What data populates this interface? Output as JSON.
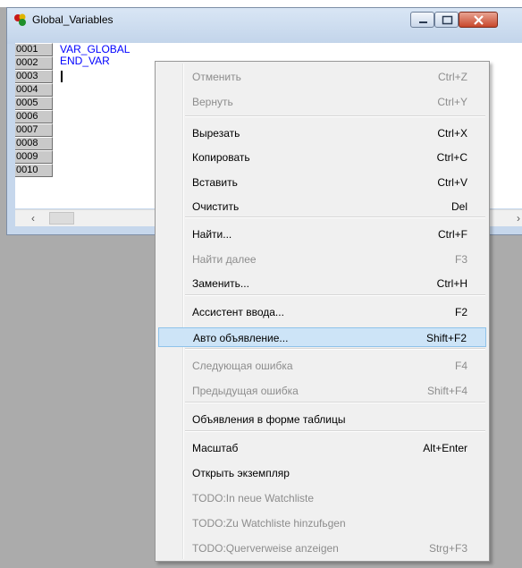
{
  "window": {
    "title": "Global_Variables",
    "line_numbers": [
      "0001",
      "0002",
      "0003",
      "0004",
      "0005",
      "0006",
      "0007",
      "0008",
      "0009",
      "0010"
    ],
    "code_lines": [
      "VAR_GLOBAL",
      "END_VAR"
    ]
  },
  "menu": {
    "items": [
      {
        "label": "Отменить",
        "shortcut": "Ctrl+Z",
        "disabled": true
      },
      {
        "label": "Вернуть",
        "shortcut": "Ctrl+Y",
        "disabled": true
      },
      {
        "label": "Вырезать",
        "shortcut": "Ctrl+X",
        "disabled": false
      },
      {
        "label": "Копировать",
        "shortcut": "Ctrl+C",
        "disabled": false
      },
      {
        "label": "Вставить",
        "shortcut": "Ctrl+V",
        "disabled": false
      },
      {
        "label": "Очистить",
        "shortcut": "Del",
        "disabled": false
      },
      {
        "label": "Найти...",
        "shortcut": "Ctrl+F",
        "disabled": false
      },
      {
        "label": "Найти далее",
        "shortcut": "F3",
        "disabled": true
      },
      {
        "label": "Заменить...",
        "shortcut": "Ctrl+H",
        "disabled": false
      },
      {
        "label": "Ассистент ввода...",
        "shortcut": "F2",
        "disabled": false
      },
      {
        "label": "Авто объявление...",
        "shortcut": "Shift+F2",
        "disabled": false,
        "selected": true
      },
      {
        "label": "Следующая ошибка",
        "shortcut": "F4",
        "disabled": true
      },
      {
        "label": "Предыдущая ошибка",
        "shortcut": "Shift+F4",
        "disabled": true
      },
      {
        "label": "Объявления в форме таблицы",
        "shortcut": "",
        "disabled": false
      },
      {
        "label": "Масштаб",
        "shortcut": "Alt+Enter",
        "disabled": false
      },
      {
        "label": "Открыть экземпляр",
        "shortcut": "",
        "disabled": false
      },
      {
        "label": "TODO:In neue Watchliste",
        "shortcut": "",
        "disabled": true
      },
      {
        "label": "TODO:Zu Watchliste hinzufьgen",
        "shortcut": "",
        "disabled": true
      },
      {
        "label": "TODO:Querverweise anzeigen",
        "shortcut": "Strg+F3",
        "disabled": true
      }
    ]
  },
  "colors": {
    "code_text": "#0000ff",
    "selection_bg": "#cde4f7",
    "disabled_text": "#8d8d8d"
  }
}
